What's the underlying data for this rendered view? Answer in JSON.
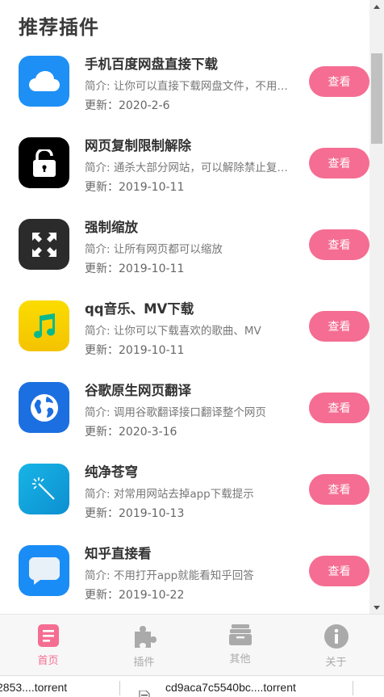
{
  "page": {
    "title": "推荐插件"
  },
  "items": [
    {
      "name": "手机百度网盘直接下载",
      "desc": "简介: 让你可以直接下载网盘文件，不用下载app",
      "date": "更新：2020-2-6",
      "button": "查看",
      "icon": "cloud-icon",
      "color": "#1e8ff5"
    },
    {
      "name": "网页复制限制解除",
      "desc": "简介: 通杀大部分网站，可以解除禁止复制的限制",
      "date": "更新：2019-10-11",
      "button": "查看",
      "icon": "unlock-icon",
      "color": "#000000"
    },
    {
      "name": "强制缩放",
      "desc": "简介: 让所有网页都可以缩放",
      "date": "更新：2019-10-11",
      "button": "查看",
      "icon": "expand-arrows-icon",
      "color": "#2b2b2b"
    },
    {
      "name": "qq音乐、MV下载",
      "desc": "简介: 让你可以下载喜欢的歌曲、MV",
      "date": "更新：2019-10-11",
      "button": "查看",
      "icon": "music-note-icon",
      "color": "#f7cc00"
    },
    {
      "name": "谷歌原生网页翻译",
      "desc": "简介: 调用谷歌翻译接口翻译整个网页",
      "date": "更新：2020-3-16",
      "button": "查看",
      "icon": "globe-icon",
      "color": "#1c6fe0"
    },
    {
      "name": "纯净苍穹",
      "desc": "简介: 对常用网站去掉app下载提示",
      "date": "更新：2019-10-13",
      "button": "查看",
      "icon": "magic-wand-icon",
      "color": "#14a3dc"
    },
    {
      "name": "知乎直接看",
      "desc": "简介: 不用打开app就能看知乎回答",
      "date": "更新：2019-10-22",
      "button": "查看",
      "icon": "chat-bubble-icon",
      "color": "#1a8cf5"
    }
  ],
  "tabs": [
    {
      "label": "首页",
      "icon": "document-icon",
      "active": true
    },
    {
      "label": "插件",
      "icon": "puzzle-icon",
      "active": false
    },
    {
      "label": "其他",
      "icon": "box-icon",
      "active": false
    },
    {
      "label": "关于",
      "icon": "info-icon",
      "active": false
    }
  ],
  "downloads": {
    "file1": "2853....torrent",
    "file2": "cd9aca7c5540bc....torrent"
  },
  "colors": {
    "accent": "#f56d92",
    "tab_inactive": "#aaaaaa"
  }
}
